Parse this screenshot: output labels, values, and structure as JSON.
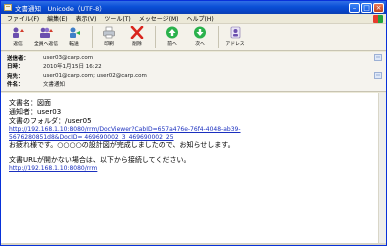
{
  "window": {
    "title": "文書通知　Unicode（UTF-8）"
  },
  "menu": [
    "ファイル(F)",
    "編集(E)",
    "表示(V)",
    "ツール(T)",
    "メッセージ(M)",
    "ヘルプ(H)"
  ],
  "toolbar": [
    {
      "label": "返信",
      "icon": "reply-icon"
    },
    {
      "label": "全員へ返信",
      "icon": "reply-all-icon"
    },
    {
      "label": "転送",
      "icon": "forward-icon"
    },
    {
      "label": "印刷",
      "icon": "printer-icon"
    },
    {
      "label": "削除",
      "icon": "delete-icon"
    },
    {
      "label": "前へ",
      "icon": "previous-icon"
    },
    {
      "label": "次へ",
      "icon": "next-icon"
    },
    {
      "label": "アドレス",
      "icon": "address-book-icon"
    }
  ],
  "header": {
    "from_label": "送信者：",
    "from": "user03@carp.com",
    "date_label": "日時：",
    "date": "2010年1月15日 16:22",
    "to_label": "宛先：",
    "to": "user01@carp.com; user02@carp.com",
    "subject_label": "件名：",
    "subject": "文書通知"
  },
  "body": {
    "doc_name": "文書名：図面",
    "notifier": "通知者：user03",
    "folder": "文書のフォルダ：/user05",
    "link1_line1": "http://192.168.1.10:8080/rrm/DocViewer?CabID=657a476e-76f4-4048-ab39-",
    "link1_line2": "5676280851d8&DocID= 469690002_3_469690002_25",
    "message": "お疲れ様です。○○○○の設計図が完成しましたので、お知らせします。",
    "cannot_open": "文書URLが開かない場合は、以下から接続してください。",
    "link2": "http://192.168.1.10:8080/rrm"
  },
  "colors": {
    "titlebar": "#0a4fd6",
    "link": "#1a2fbf",
    "delete_accent": "#d9251d",
    "nav_accent": "#2bb24c"
  }
}
